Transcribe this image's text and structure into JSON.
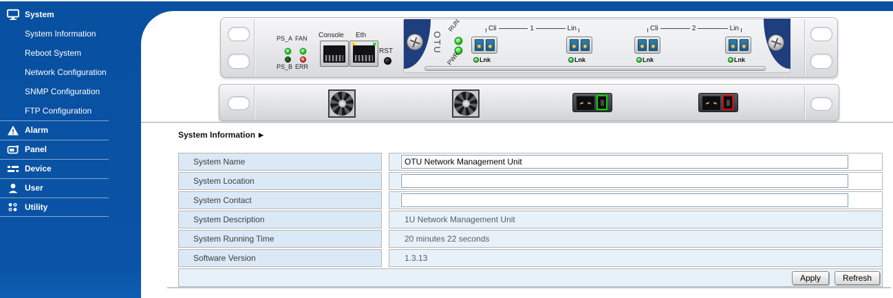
{
  "sidebar": {
    "items": [
      {
        "label": "System",
        "level": "top",
        "icon": "monitor-icon"
      },
      {
        "label": "System Information",
        "level": "sub"
      },
      {
        "label": "Reboot System",
        "level": "sub"
      },
      {
        "label": "Network Configuration",
        "level": "sub"
      },
      {
        "label": "SNMP Configuration",
        "level": "sub"
      },
      {
        "label": "FTP Configuration",
        "level": "sub"
      },
      {
        "label": "Alarm",
        "level": "top",
        "icon": "alarm-icon"
      },
      {
        "label": "Panel",
        "level": "top",
        "icon": "panel-icon"
      },
      {
        "label": "Device",
        "level": "top",
        "icon": "device-icon"
      },
      {
        "label": "User",
        "level": "top",
        "icon": "user-icon"
      },
      {
        "label": "Utility",
        "level": "top",
        "icon": "utility-icon"
      }
    ]
  },
  "device": {
    "front": {
      "led_labels": {
        "ps_a": "PS_A",
        "fan": "FAN",
        "ps_b": "PS_B",
        "err": "ERR"
      },
      "ports": {
        "console": "Console",
        "eth": "Eth"
      },
      "reset": "RST",
      "card": {
        "name": "OTU",
        "run": "RUN",
        "pwr": "PWR",
        "groups": [
          {
            "cli": "Cli",
            "num": "1",
            "lin": "Lin",
            "lnk_cli": "Lnk",
            "lnk_lin": "Lnk"
          },
          {
            "cli": "Cli",
            "num": "2",
            "lin": "Lin",
            "lnk_cli": "Lnk",
            "lnk_lin": "Lnk"
          }
        ]
      }
    }
  },
  "main": {
    "title": "System Information",
    "title_arrow": "▶",
    "rows": [
      {
        "label": "System Name",
        "type": "input",
        "value": "OTU Network Management Unit"
      },
      {
        "label": "System Location",
        "type": "input",
        "value": ""
      },
      {
        "label": "System Contact",
        "type": "input",
        "value": ""
      },
      {
        "label": "System Description",
        "type": "text",
        "value": "1U Network Management Unit"
      },
      {
        "label": "System Running Time",
        "type": "text",
        "value": "20 minutes 22 seconds"
      },
      {
        "label": "Software Version",
        "type": "text",
        "value": "1.3.13"
      }
    ],
    "buttons": {
      "apply": "Apply",
      "refresh": "Refresh"
    }
  },
  "colors": {
    "brand_blue": "#0950a2",
    "label_cell_bg": "#dbe9f7",
    "value_cell_bg": "#e7f1fa",
    "led_green": "#33dd33",
    "led_red": "#e01818",
    "power_ok_green": "#00d800",
    "power_err_red": "#e80000"
  }
}
